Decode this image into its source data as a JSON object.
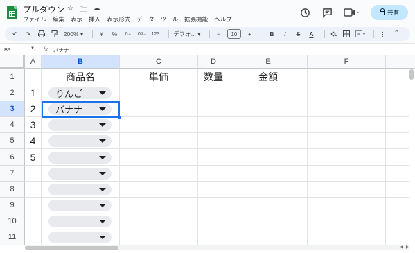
{
  "app": {
    "title": "プルダウン",
    "title_icons": [
      "☆",
      "🗀",
      "☁"
    ],
    "menu": [
      "ファイル",
      "編集",
      "表示",
      "挿入",
      "表示形式",
      "データ",
      "ツール",
      "拡張機能",
      "ヘルプ"
    ],
    "share_label": "共有"
  },
  "toolbar": {
    "zoom": "200%",
    "currency": "¥",
    "percent": "%",
    "dec_decrease": ".0←",
    "dec_increase": ".00",
    "number_format": "123",
    "font": "デフォ...",
    "font_size": "10",
    "minus": "−",
    "plus": "+",
    "bold": "B",
    "italic": "I",
    "strike": "S",
    "text_color": "A"
  },
  "formula_bar": {
    "cell_ref": "B3",
    "fx": "fx",
    "value": "バナナ"
  },
  "columns": [
    "A",
    "B",
    "C",
    "D",
    "E",
    "F"
  ],
  "rows": [
    "1",
    "2",
    "3",
    "4",
    "5",
    "6",
    "7",
    "8",
    "9",
    "10",
    "11"
  ],
  "header_row": {
    "b": "商品名",
    "c": "単価",
    "d": "数量",
    "e": "金額"
  },
  "data_rows": [
    {
      "a": "1",
      "b": "りんご"
    },
    {
      "a": "2",
      "b": "バナナ"
    },
    {
      "a": "3",
      "b": ""
    },
    {
      "a": "4",
      "b": ""
    },
    {
      "a": "5",
      "b": ""
    },
    {
      "a": "",
      "b": ""
    },
    {
      "a": "",
      "b": ""
    },
    {
      "a": "",
      "b": ""
    },
    {
      "a": "",
      "b": ""
    },
    {
      "a": "",
      "b": ""
    }
  ],
  "colors": {
    "accent": "#1a73e8",
    "share_bg": "#c2e7ff",
    "selected_header": "#d3e3fd",
    "chip_bg": "#e8eaed",
    "brand_green": "#1e8e3e"
  }
}
